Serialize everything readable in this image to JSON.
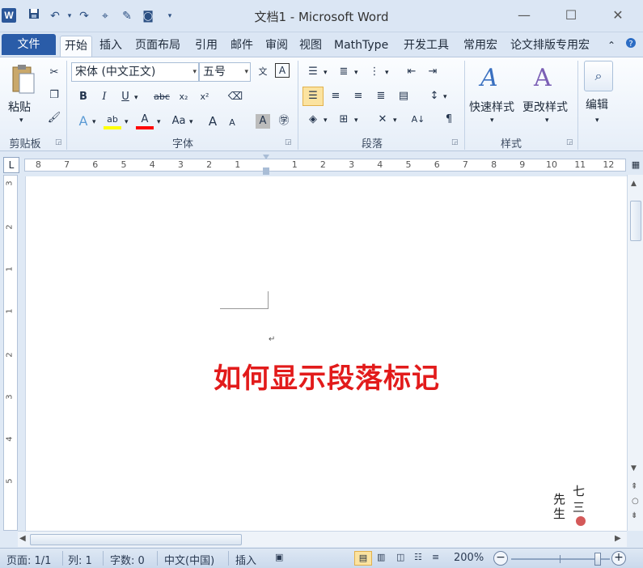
{
  "window": {
    "title": "文档1 - Microsoft Word",
    "app_logo": "W",
    "minimize": "—",
    "maximize": "☐",
    "close": "✕"
  },
  "quick_access": {
    "save_icon": "save-icon",
    "undo_icon": "undo-icon",
    "redo_icon": "redo-icon"
  },
  "tabs": {
    "file": "文件",
    "items": [
      "开始",
      "插入",
      "页面布局",
      "引用",
      "邮件",
      "审阅",
      "视图",
      "MathType",
      "开发工具",
      "常用宏",
      "论文排版专用宏"
    ],
    "active": "开始"
  },
  "ribbon": {
    "clipboard": {
      "paste_label": "粘贴",
      "group_label": "剪贴板"
    },
    "font": {
      "font_name": "宋体 (中文正文)",
      "font_size": "五号",
      "group_label": "字体",
      "bold": "B",
      "italic": "I",
      "underline": "U",
      "strike": "abc",
      "subscript": "x₂",
      "superscript": "x²",
      "grow": "A",
      "shrink": "A",
      "case": "Aa",
      "highlight_color": "#ffff00",
      "font_color": "#ff0000"
    },
    "paragraph": {
      "group_label": "段落"
    },
    "styles": {
      "quick_styles": "快速样式",
      "change_styles": "更改样式",
      "group_label": "样式"
    },
    "editing": {
      "label": "编辑"
    }
  },
  "ruler": {
    "left_numbers": [
      "8",
      "7",
      "6",
      "5",
      "4",
      "3",
      "2",
      "1"
    ],
    "right_numbers": [
      "1",
      "2",
      "3",
      "4",
      "5",
      "6",
      "7",
      "8",
      "9",
      "10",
      "11",
      "12"
    ],
    "vertical_numbers": [
      "3",
      "2",
      "1",
      "1",
      "2",
      "3",
      "4",
      "5"
    ]
  },
  "document": {
    "heading": "如何显示段落标记",
    "heading_color": "#e21b1b",
    "paragraph_mark": "↵"
  },
  "stamp": {
    "text": "七三先生"
  },
  "status": {
    "page": "页面: 1/1",
    "column": "列: 1",
    "word_count": "字数: 0",
    "language": "中文(中国)",
    "mode": "插入",
    "zoom": "200%",
    "zoom_fraction": 0.88
  }
}
